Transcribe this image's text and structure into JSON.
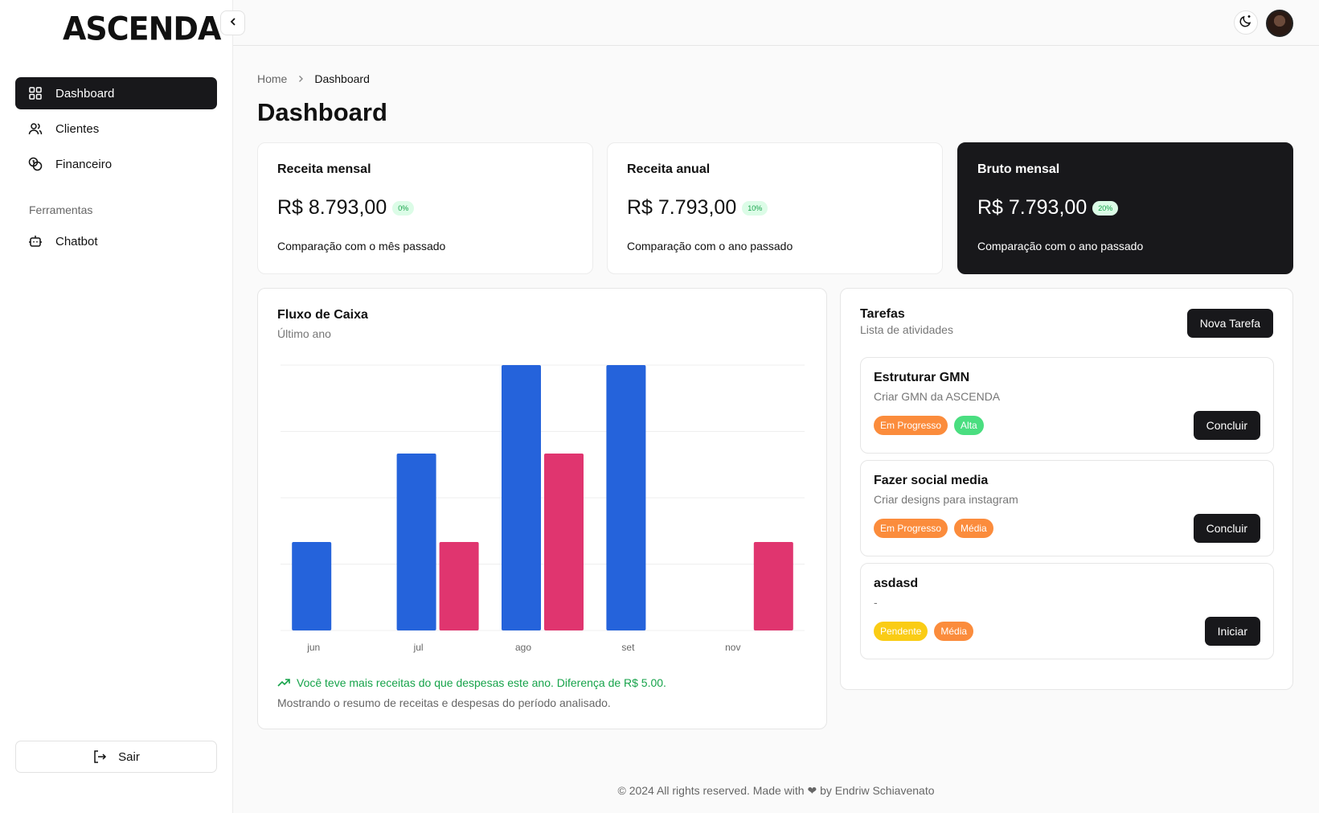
{
  "app": {
    "logo_text": "ASCENDA"
  },
  "sidebar": {
    "items": [
      {
        "label": "Dashboard",
        "icon": "grid-icon",
        "active": true
      },
      {
        "label": "Clientes",
        "icon": "users-icon",
        "active": false
      },
      {
        "label": "Financeiro",
        "icon": "coins-icon",
        "active": false
      }
    ],
    "section_label": "Ferramentas",
    "tools": [
      {
        "label": "Chatbot",
        "icon": "bot-icon"
      }
    ],
    "logout_label": "Sair"
  },
  "breadcrumb": {
    "home": "Home",
    "current": "Dashboard"
  },
  "page_title": "Dashboard",
  "stats": [
    {
      "title": "Receita mensal",
      "value": "R$ 8.793,00",
      "badge": "0%",
      "desc": "Comparação com o mês passado"
    },
    {
      "title": "Receita anual",
      "value": "R$ 7.793,00",
      "badge": "10%",
      "desc": "Comparação com o ano passado"
    },
    {
      "title": "Bruto mensal",
      "value": "R$ 7.793,00",
      "badge": "20%",
      "desc": "Comparação com o ano passado"
    }
  ],
  "cashflow": {
    "title": "Fluxo de Caixa",
    "subtitle": "Último ano",
    "trend_text": "Você teve mais receitas do que despesas este ano. Diferença de R$ 5.00.",
    "footer_text": "Mostrando o resumo de receitas e despesas do período analisado."
  },
  "chart_data": {
    "type": "bar",
    "categories": [
      "jun",
      "jul",
      "ago",
      "set",
      "nov"
    ],
    "series": [
      {
        "values": [
          1,
          2,
          3,
          3,
          0
        ],
        "color": "#2563db"
      },
      {
        "values": [
          0,
          1,
          2,
          0,
          1
        ],
        "color": "#e0356f"
      }
    ],
    "ylim": [
      0,
      3
    ],
    "grid": true
  },
  "tasks": {
    "title": "Tarefas",
    "subtitle": "Lista de atividades",
    "new_button": "Nova Tarefa",
    "items": [
      {
        "title": "Estruturar GMN",
        "desc": "Criar GMN da ASCENDA",
        "status": "Em Progresso",
        "status_color": "orange",
        "priority": "Alta",
        "priority_color": "green",
        "action": "Concluir"
      },
      {
        "title": "Fazer social media",
        "desc": "Criar designs para instagram",
        "status": "Em Progresso",
        "status_color": "orange",
        "priority": "Média",
        "priority_color": "orange",
        "action": "Concluir"
      },
      {
        "title": "asdasd",
        "desc": "-",
        "status": "Pendente",
        "status_color": "yellow",
        "priority": "Média",
        "priority_color": "orange",
        "action": "Iniciar"
      }
    ]
  },
  "footer": {
    "text": "© 2024 All rights reserved. Made with ❤ by Endriw Schiavenato"
  }
}
